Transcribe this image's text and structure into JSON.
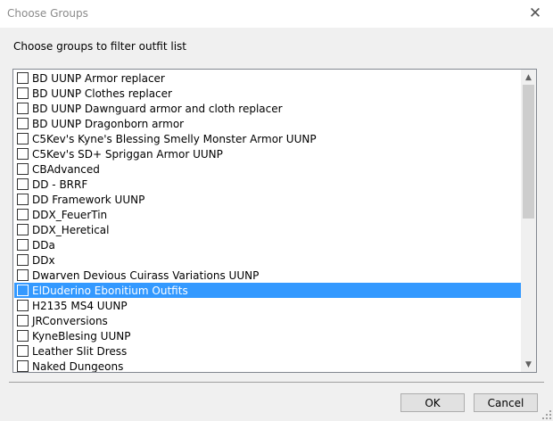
{
  "window": {
    "title": "Choose Groups",
    "close_glyph": "✕"
  },
  "prompt": "Choose groups to filter outfit list",
  "groups": [
    {
      "label": "BD UUNP Armor replacer",
      "checked": false,
      "selected": false
    },
    {
      "label": "BD UUNP Clothes replacer",
      "checked": false,
      "selected": false
    },
    {
      "label": "BD UUNP Dawnguard armor and cloth replacer",
      "checked": false,
      "selected": false
    },
    {
      "label": "BD UUNP Dragonborn armor",
      "checked": false,
      "selected": false
    },
    {
      "label": "C5Kev's Kyne's Blessing Smelly Monster Armor UUNP",
      "checked": false,
      "selected": false
    },
    {
      "label": "C5Kev's SD+ Spriggan Armor UUNP",
      "checked": false,
      "selected": false
    },
    {
      "label": "CBAdvanced",
      "checked": false,
      "selected": false
    },
    {
      "label": "DD - BRRF",
      "checked": false,
      "selected": false
    },
    {
      "label": "DD Framework UUNP",
      "checked": false,
      "selected": false
    },
    {
      "label": "DDX_FeuerTin",
      "checked": false,
      "selected": false
    },
    {
      "label": "DDX_Heretical",
      "checked": false,
      "selected": false
    },
    {
      "label": "DDa",
      "checked": false,
      "selected": false
    },
    {
      "label": "DDx",
      "checked": false,
      "selected": false
    },
    {
      "label": "Dwarven Devious Cuirass Variations UUNP",
      "checked": false,
      "selected": false
    },
    {
      "label": "ElDuderino Ebonitium Outfits",
      "checked": false,
      "selected": true
    },
    {
      "label": "H2135 MS4 UUNP",
      "checked": false,
      "selected": false
    },
    {
      "label": "JRConversions",
      "checked": false,
      "selected": false
    },
    {
      "label": "KyneBlesing UUNP",
      "checked": false,
      "selected": false
    },
    {
      "label": "Leather Slit Dress",
      "checked": false,
      "selected": false
    },
    {
      "label": "Naked Dungeons",
      "checked": false,
      "selected": false
    }
  ],
  "scrollbar": {
    "up_glyph": "▲",
    "down_glyph": "▼"
  },
  "buttons": {
    "ok": "OK",
    "cancel": "Cancel"
  },
  "colors": {
    "selection": "#3399ff",
    "dialog_bg": "#f0f0f0"
  }
}
